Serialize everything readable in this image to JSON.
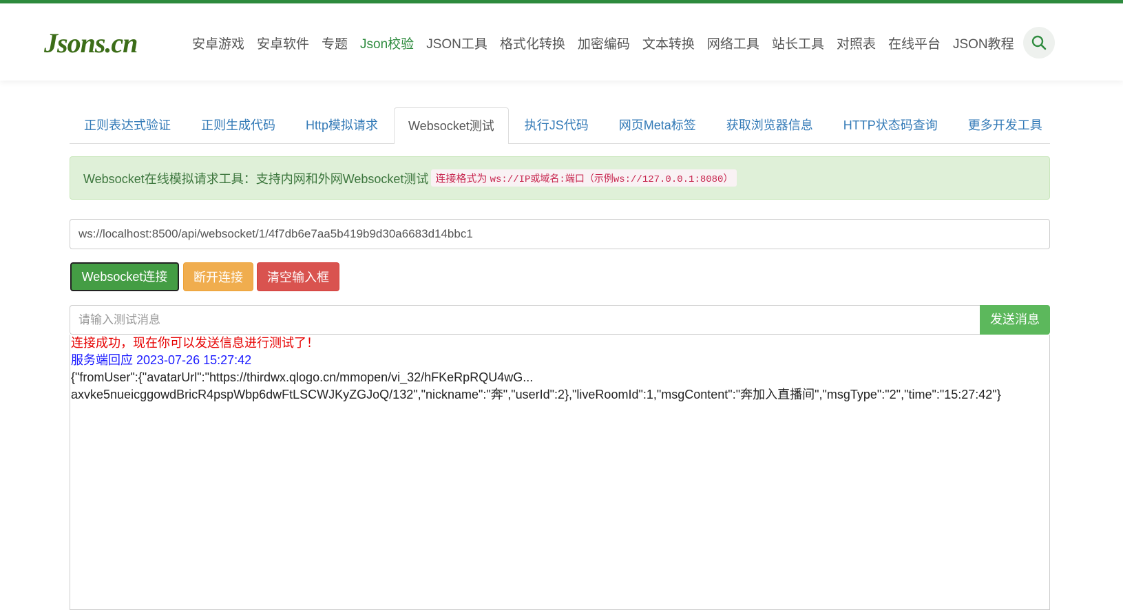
{
  "site": {
    "logo": "Jsons.cn",
    "nav": [
      {
        "label": "安卓游戏"
      },
      {
        "label": "安卓软件"
      },
      {
        "label": "专题"
      },
      {
        "label": "Json校验"
      },
      {
        "label": "JSON工具"
      },
      {
        "label": "格式化转换"
      },
      {
        "label": "加密编码"
      },
      {
        "label": "文本转换"
      },
      {
        "label": "网络工具"
      },
      {
        "label": "站长工具"
      },
      {
        "label": "对照表"
      },
      {
        "label": "在线平台"
      },
      {
        "label": "JSON教程"
      }
    ],
    "search_icon": "search-icon",
    "accent_color": "#2e8b3e"
  },
  "tabs": [
    {
      "label": "正则表达式验证"
    },
    {
      "label": "正则生成代码"
    },
    {
      "label": "Http模拟请求"
    },
    {
      "label": "Websocket测试"
    },
    {
      "label": "执行JS代码"
    },
    {
      "label": "网页Meta标签"
    },
    {
      "label": "获取浏览器信息"
    },
    {
      "label": "HTTP状态码查询"
    },
    {
      "label": "更多开发工具"
    }
  ],
  "active_tab": "Websocket测试",
  "notice": {
    "text": "Websocket在线模拟请求工具：支持内网和外网Websocket测试",
    "format_prefix": "连接格式为",
    "format_ws": "ws://IP或域名:端口（示例ws://127.0.0.1:8080）"
  },
  "url_input": {
    "value": "ws://localhost:8500/api/websocket/1/4f7db6e7aa5b419b9d30a6683d14bbc1"
  },
  "buttons": {
    "connect": "Websocket连接",
    "disconnect": "断开连接",
    "clear": "清空输入框",
    "send": "发送消息"
  },
  "message_input": {
    "placeholder": "请输入测试消息"
  },
  "log": {
    "success": "连接成功，现在你可以发送信息进行测试了！",
    "server_reply": "服务端回应 2023-07-26 15:27:42",
    "data_line1": "{\"fromUser\":{\"avatarUrl\":\"https://thirdwx.qlogo.cn/mmopen/vi_32/hFKeRpRQU4wG...",
    "data_line2": "axvke5nueicggowdBricR4pspWbp6dwFtLSCWJKyZGJoQ/132\",\"nickname\":\"奔\",\"userId\":2},\"liveRoomId\":1,\"msgContent\":\"奔加入直播间\",\"msgType\":\"2\",\"time\":\"15:27:42\"}"
  }
}
